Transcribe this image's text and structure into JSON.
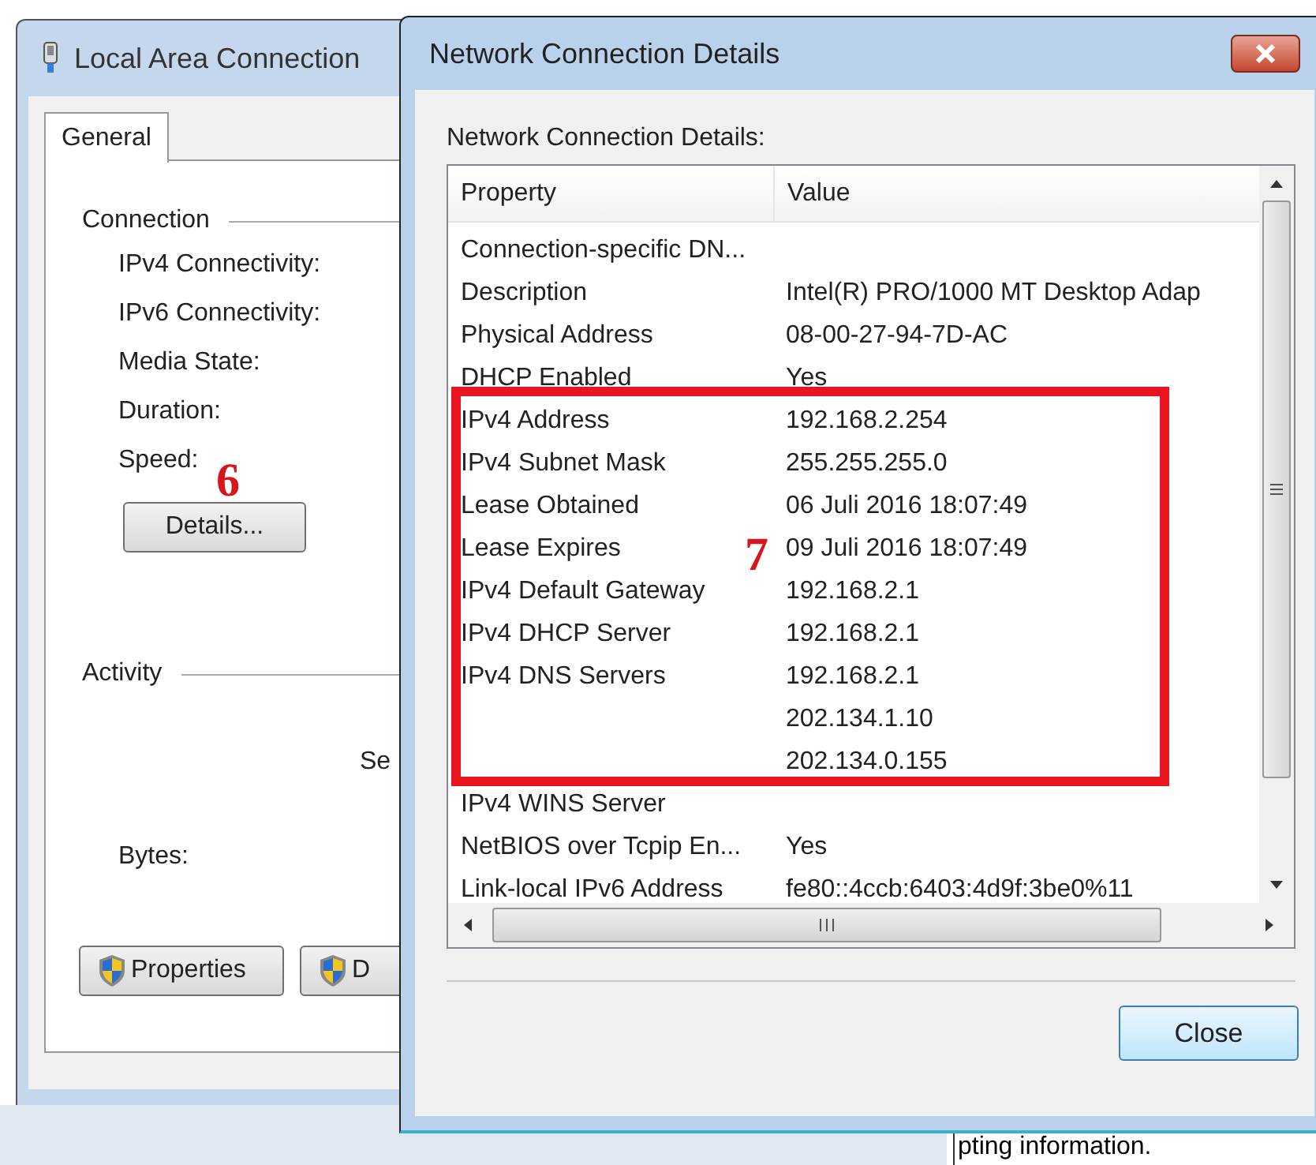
{
  "background_window": {
    "title": "Local Area Connection",
    "tabs": [
      {
        "label": "General",
        "selected": true
      }
    ],
    "connection": {
      "label": "Connection",
      "fields": [
        "IPv4 Connectivity:",
        "IPv6 Connectivity:",
        "Media State:",
        "Duration:",
        "Speed:"
      ],
      "details_button": "Details..."
    },
    "activity": {
      "label": "Activity",
      "column_1": "Se",
      "bytes_label": "Bytes:"
    },
    "buttons": [
      {
        "label": "Properties",
        "shield": true
      },
      {
        "label": "D",
        "shield": true
      }
    ]
  },
  "dialog": {
    "title": "Network Connection Details",
    "list_label": "Network Connection Details:",
    "columns": [
      "Property",
      "Value"
    ],
    "rows": [
      {
        "property": "Connection-specific DN..."
      },
      {
        "property": "Description",
        "value": "Intel(R) PRO/1000 MT Desktop Adap"
      },
      {
        "property": "Physical Address",
        "value": "08-00-27-94-7D-AC"
      },
      {
        "property": "DHCP Enabled",
        "value": "Yes"
      },
      {
        "property": "IPv4 Address",
        "value": "192.168.2.254"
      },
      {
        "property": "IPv4 Subnet Mask",
        "value": "255.255.255.0"
      },
      {
        "property": "Lease Obtained",
        "value": "06 Juli 2016 18:07:49"
      },
      {
        "property": "Lease Expires",
        "value": "09 Juli 2016 18:07:49"
      },
      {
        "property": "IPv4 Default Gateway",
        "value": "192.168.2.1"
      },
      {
        "property": "IPv4 DHCP Server",
        "value": "192.168.2.1"
      },
      {
        "property": "IPv4 DNS Servers",
        "value": "192.168.2.1"
      },
      {
        "value": "202.134.1.10"
      },
      {
        "value": "202.134.0.155"
      },
      {
        "property": "IPv4 WINS Server"
      },
      {
        "property": "NetBIOS over Tcpip En...",
        "value": "Yes"
      },
      {
        "property": "Link-local IPv6 Address",
        "value": "fe80::4ccb:6403:4d9f:3be0%11"
      }
    ],
    "close_button": "Close"
  },
  "annotations": [
    {
      "kind": "number",
      "text": "6"
    },
    {
      "kind": "number",
      "text": "7"
    },
    {
      "kind": "frame"
    }
  ],
  "background_text": "pting information."
}
